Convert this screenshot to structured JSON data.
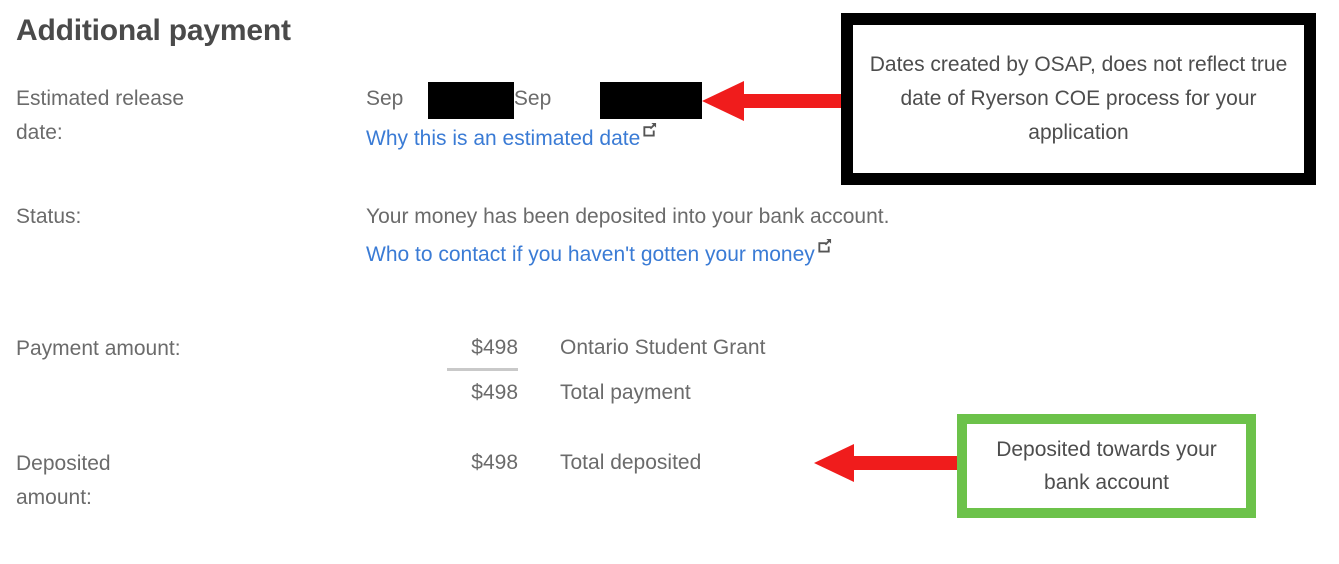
{
  "heading": "Additional payment",
  "colors": {
    "link": "#3a7bd5",
    "text": "#6b6b6b",
    "heading": "#4a4a4a",
    "arrow_red": "#f01c1c",
    "annotation_green": "#6cc24a",
    "annotation_black": "#000000",
    "redaction": "#000000",
    "subtotal_rule": "#c9c9c9"
  },
  "fields": {
    "release_date": {
      "label": "Estimated release date:",
      "label_line1": "Estimated release",
      "label_line2": "date:",
      "value_prefix": "Sep",
      "value_separator": "-",
      "value_suffix": "Sep",
      "value_redacted_1": "",
      "value_redacted_2": "",
      "link_text": "Why this is an estimated date",
      "link_icon": "external-link-icon"
    },
    "status": {
      "label": "Status:",
      "value": "Your money has been deposited into your bank account.",
      "link_text": "Who to contact if you haven't gotten your money",
      "link_icon": "external-link-icon"
    },
    "payment_amount": {
      "label": "Payment amount:"
    },
    "deposited_amount": {
      "label": "Deposited amount:",
      "label_line1": "Deposited",
      "label_line2": "amount:"
    }
  },
  "amounts": {
    "payment_rows": [
      {
        "value": "$498",
        "description": "Ontario Student Grant"
      },
      {
        "value": "$498",
        "description": "Total payment"
      }
    ],
    "deposited_rows": [
      {
        "value": "$498",
        "description": "Total deposited"
      }
    ]
  },
  "annotations": [
    {
      "id": "dates-note",
      "text": "Dates created by OSAP, does not reflect true date of Ryerson COE process for your application",
      "border_color": "#000000",
      "arrow": "left-arrow-red"
    },
    {
      "id": "deposit-note",
      "text": "Deposited towards your bank account",
      "border_color": "#6cc24a",
      "arrow": "left-arrow-red"
    }
  ]
}
